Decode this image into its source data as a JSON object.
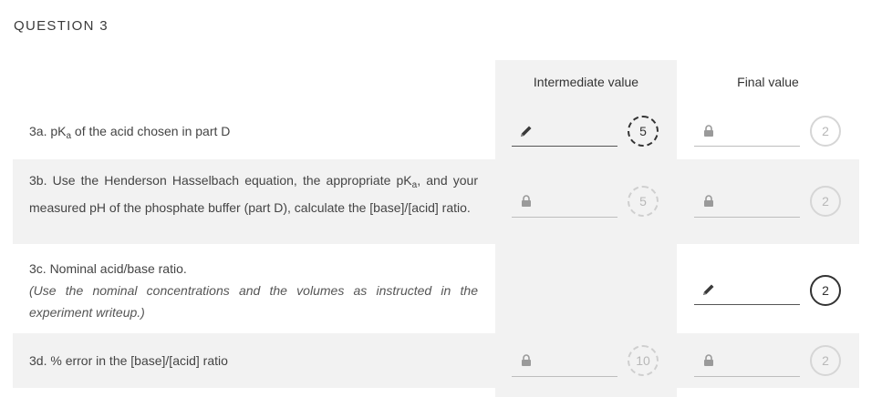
{
  "question": {
    "title": "QUESTION 3"
  },
  "columns": {
    "intermediate": "Intermediate value",
    "final": "Final value"
  },
  "rows": [
    {
      "label_pre": "3a. pK",
      "label_sub": "a",
      "label_post": " of the acid chosen in part D",
      "intermediate": {
        "state": "editable",
        "icon": "pencil-icon",
        "points": "5"
      },
      "final": {
        "state": "locked",
        "icon": "lock-icon",
        "points": "2"
      }
    },
    {
      "label_pre": "3b. Use the Henderson Hasselbach equation, the appropriate pK",
      "label_sub": "a",
      "label_post": ", and your measured pH of the phosphate buffer (part D), calculate the [base]/[acid] ratio.",
      "intermediate": {
        "state": "locked",
        "icon": "lock-icon",
        "points": "5"
      },
      "final": {
        "state": "locked",
        "icon": "lock-icon",
        "points": "2"
      }
    },
    {
      "label_pre": "3c. Nominal acid/base ratio.",
      "label_note": "(Use the nominal concentrations and the volumes as instructed in the experiment writeup.)",
      "final": {
        "state": "editable",
        "icon": "pencil-icon",
        "points": "2"
      }
    },
    {
      "label_pre": "3d. % error in the [base]/[acid] ratio",
      "intermediate": {
        "state": "locked",
        "icon": "lock-icon",
        "points": "10"
      },
      "final": {
        "state": "locked",
        "icon": "lock-icon",
        "points": "2"
      }
    }
  ]
}
